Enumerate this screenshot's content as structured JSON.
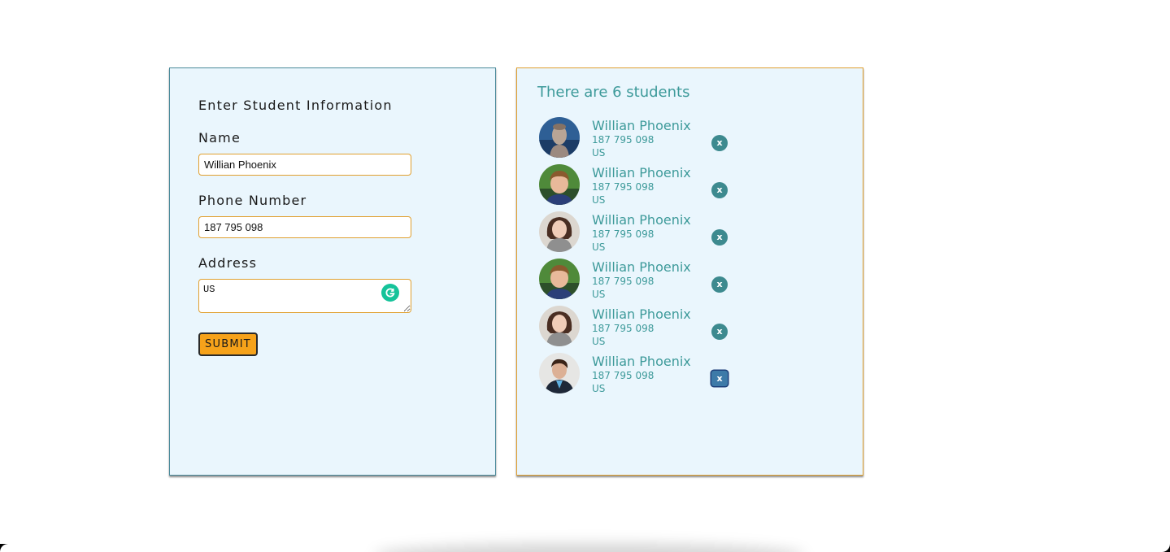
{
  "form": {
    "title": "Enter Student Information",
    "name_label": "Name",
    "name_value": "Willian Phoenix",
    "phone_label": "Phone Number",
    "phone_value": "187 795 098",
    "address_label": "Address",
    "address_value": "US",
    "submit_label": "SUBMIT"
  },
  "list": {
    "title": "There are 6 students",
    "remove_label": "x",
    "students": [
      {
        "name": "Willian Phoenix",
        "phone": "187 795 098",
        "address": "US",
        "avatar": "man-portrait-blue"
      },
      {
        "name": "Willian Phoenix",
        "phone": "187 795 098",
        "address": "US",
        "avatar": "boy-portrait-green"
      },
      {
        "name": "Willian Phoenix",
        "phone": "187 795 098",
        "address": "US",
        "avatar": "woman-portrait-scarf"
      },
      {
        "name": "Willian Phoenix",
        "phone": "187 795 098",
        "address": "US",
        "avatar": "boy-portrait-green"
      },
      {
        "name": "Willian Phoenix",
        "phone": "187 795 098",
        "address": "US",
        "avatar": "woman-portrait-scarf"
      },
      {
        "name": "Willian Phoenix",
        "phone": "187 795 098",
        "address": "US",
        "avatar": "man-portrait-suit"
      }
    ]
  },
  "colors": {
    "panel_bg": "#eaf6fd",
    "accent_orange": "#f6a21a",
    "teal_text": "#3d9a9a",
    "grammarly_green": "#15c39a"
  }
}
